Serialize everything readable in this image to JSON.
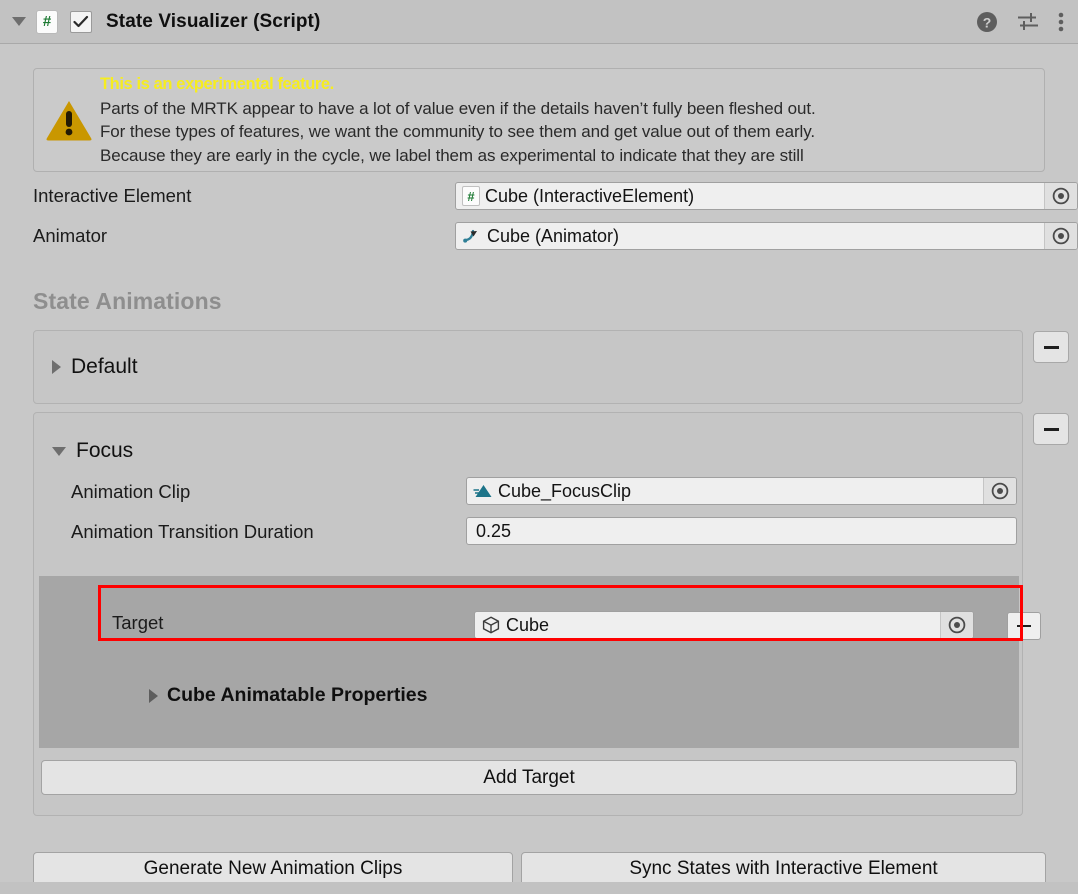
{
  "component": {
    "title": "State Visualizer (Script)",
    "script_badge": "#",
    "enabled": true,
    "help_icon": "help-icon",
    "preset_icon": "preset-icon",
    "menu_icon": "kebab-menu-icon",
    "foldout_icon": "chevron-down-icon"
  },
  "helpbox": {
    "icon": "warning-triangle-icon",
    "title": "This is an experimental feature.",
    "lines": [
      "Parts of the MRTK appear to have a lot of value even if the details haven’t fully been fleshed out.",
      "For these types of features, we want the community to see them and get value out of them early.",
      "Because they are early in the cycle, we label them as experimental to indicate that they are still"
    ]
  },
  "properties": [
    {
      "label": "Interactive Element",
      "value": "Cube (InteractiveElement)",
      "icon": "cs-script-icon",
      "picker_icon": "object-picker-icon"
    },
    {
      "label": "Animator",
      "value": "Cube (Animator)",
      "icon": "animator-icon",
      "picker_icon": "object-picker-icon"
    }
  ],
  "section": {
    "title": "State Animations"
  },
  "states": [
    {
      "name": "Default",
      "expanded": false,
      "foldout_icon": "chevron-right-icon",
      "remove_label": "remove-state-button"
    },
    {
      "name": "Focus",
      "expanded": true,
      "foldout_icon": "chevron-down-icon",
      "remove_label": "remove-state-button",
      "fields": [
        {
          "label": "Animation Clip",
          "value": "Cube_FocusClip",
          "icon": "animation-clip-icon",
          "picker_icon": "object-picker-icon"
        },
        {
          "label": "Animation Transition Duration",
          "value": "0.25"
        }
      ],
      "target": {
        "label": "Target",
        "value": "Cube",
        "icon": "gameobject-cube-icon",
        "picker_icon": "object-picker-icon",
        "remove_label": "remove-target-button",
        "highlight_color": "#fe0000"
      },
      "animatable_properties": {
        "label": "Cube Animatable Properties",
        "foldout_icon": "chevron-right-icon",
        "expanded": false
      },
      "add_target_label": "Add Target"
    }
  ],
  "footer": {
    "generate_label": "Generate New Animation Clips",
    "sync_label": "Sync States with Interactive Element"
  },
  "colors": {
    "panel_bg": "#c8c8c8",
    "header_bg": "#c2c2c2",
    "field_bg": "#efefef",
    "target_panel_bg": "#a6a6a6",
    "warning_yellow": "#f6ed1f",
    "warning_icon": "#c99700",
    "section_title": "#8e8e8e",
    "highlight": "#fe0000"
  }
}
